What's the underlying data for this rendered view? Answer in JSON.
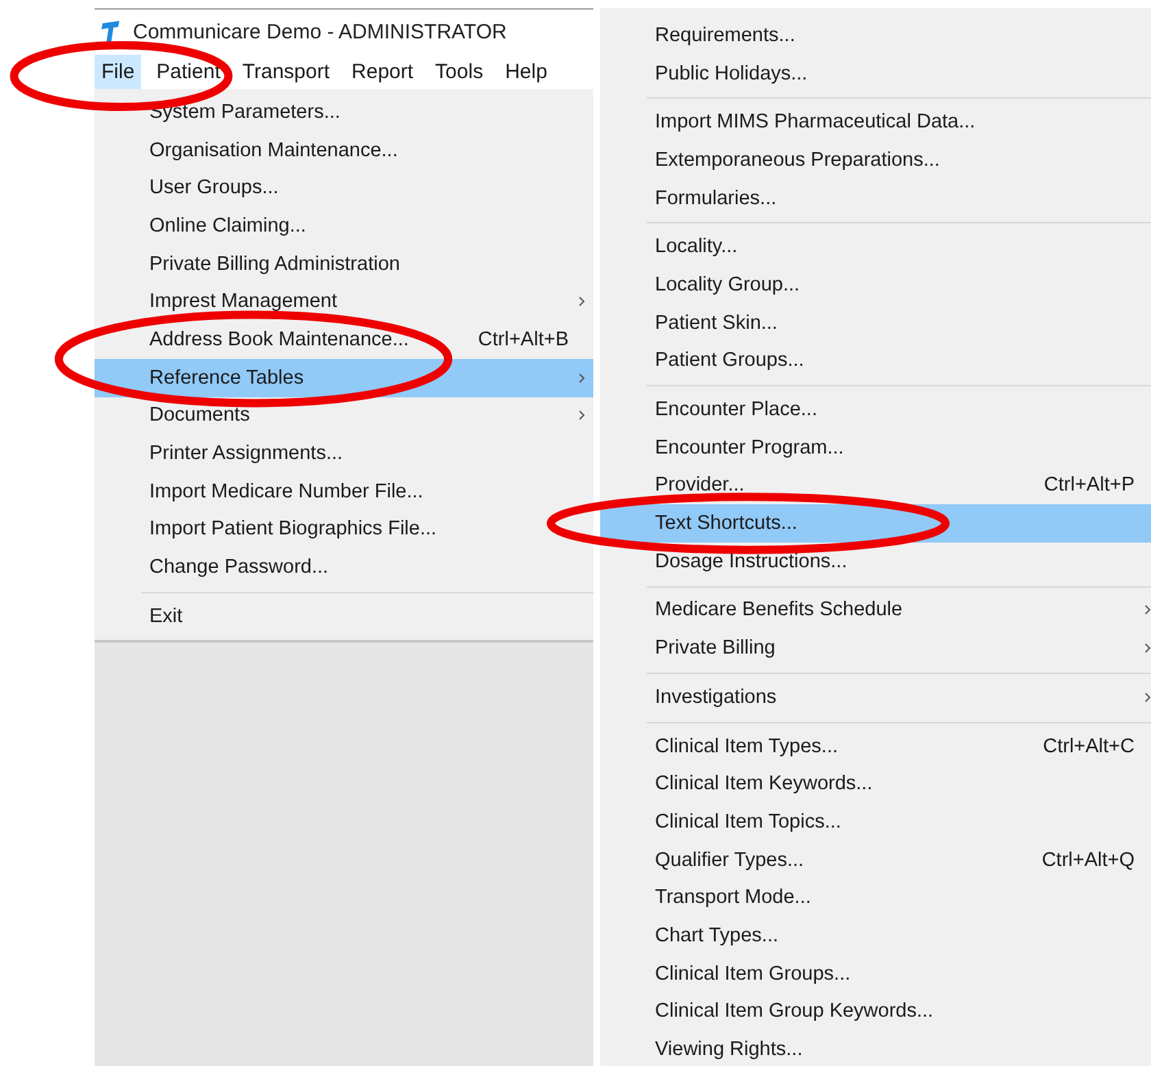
{
  "window": {
    "title": "Communicare Demo - ADMINISTRATOR"
  },
  "menubar": [
    {
      "label": "File",
      "selected": true,
      "circled": true
    },
    {
      "label": "Patient",
      "selected": false,
      "circled": false
    },
    {
      "label": "Transport",
      "selected": false,
      "circled": false
    },
    {
      "label": "Report",
      "selected": false,
      "circled": false
    },
    {
      "label": "Tools",
      "selected": false,
      "circled": false
    },
    {
      "label": "Help",
      "selected": false,
      "circled": false
    }
  ],
  "file_menu": {
    "items": [
      {
        "kind": "item",
        "label": "System Parameters...",
        "submenu": false,
        "selected": false,
        "circled": false
      },
      {
        "kind": "item",
        "label": "Organisation Maintenance...",
        "submenu": false,
        "selected": false,
        "circled": false
      },
      {
        "kind": "item",
        "label": "User Groups...",
        "submenu": false,
        "selected": false,
        "circled": false
      },
      {
        "kind": "item",
        "label": "Online Claiming...",
        "submenu": false,
        "selected": false,
        "circled": false
      },
      {
        "kind": "item",
        "label": "Private Billing Administration",
        "submenu": false,
        "selected": false,
        "circled": false
      },
      {
        "kind": "item",
        "label": "Imprest Management",
        "submenu": true,
        "selected": false,
        "circled": false
      },
      {
        "kind": "item",
        "label": "Address Book Maintenance...",
        "shortcut": "Ctrl+Alt+B",
        "submenu": false,
        "selected": false,
        "circled": false
      },
      {
        "kind": "item",
        "label": "Reference Tables",
        "submenu": true,
        "selected": true,
        "circled": true
      },
      {
        "kind": "item",
        "label": "Documents",
        "submenu": true,
        "selected": false,
        "circled": false
      },
      {
        "kind": "item",
        "label": "Printer Assignments...",
        "submenu": false,
        "selected": false,
        "circled": false
      },
      {
        "kind": "item",
        "label": "Import Medicare Number File...",
        "submenu": false,
        "selected": false,
        "circled": false
      },
      {
        "kind": "item",
        "label": "Import Patient Biographics File...",
        "submenu": false,
        "selected": false,
        "circled": false
      },
      {
        "kind": "item",
        "label": "Change Password...",
        "submenu": false,
        "selected": false,
        "circled": false
      },
      {
        "kind": "separator"
      },
      {
        "kind": "item",
        "label": "Exit",
        "submenu": false,
        "selected": false,
        "circled": false
      }
    ]
  },
  "reference_tables_menu": {
    "items": [
      {
        "kind": "item",
        "label": "Requirements...",
        "submenu": false,
        "selected": false,
        "circled": false
      },
      {
        "kind": "item",
        "label": "Public Holidays...",
        "submenu": false,
        "selected": false,
        "circled": false
      },
      {
        "kind": "separator"
      },
      {
        "kind": "item",
        "label": "Import MIMS Pharmaceutical Data...",
        "submenu": false,
        "selected": false,
        "circled": false
      },
      {
        "kind": "item",
        "label": "Extemporaneous Preparations...",
        "submenu": false,
        "selected": false,
        "circled": false
      },
      {
        "kind": "item",
        "label": "Formularies...",
        "submenu": false,
        "selected": false,
        "circled": false
      },
      {
        "kind": "separator"
      },
      {
        "kind": "item",
        "label": "Locality...",
        "submenu": false,
        "selected": false,
        "circled": false
      },
      {
        "kind": "item",
        "label": "Locality Group...",
        "submenu": false,
        "selected": false,
        "circled": false
      },
      {
        "kind": "item",
        "label": "Patient Skin...",
        "submenu": false,
        "selected": false,
        "circled": false
      },
      {
        "kind": "item",
        "label": "Patient Groups...",
        "submenu": false,
        "selected": false,
        "circled": false
      },
      {
        "kind": "separator"
      },
      {
        "kind": "item",
        "label": "Encounter Place...",
        "submenu": false,
        "selected": false,
        "circled": false
      },
      {
        "kind": "item",
        "label": "Encounter Program...",
        "submenu": false,
        "selected": false,
        "circled": false
      },
      {
        "kind": "item",
        "label": "Provider...",
        "shortcut": "Ctrl+Alt+P",
        "submenu": false,
        "selected": false,
        "circled": false
      },
      {
        "kind": "item",
        "label": "Text Shortcuts...",
        "submenu": false,
        "selected": true,
        "circled": true
      },
      {
        "kind": "item",
        "label": "Dosage Instructions...",
        "submenu": false,
        "selected": false,
        "circled": false
      },
      {
        "kind": "separator"
      },
      {
        "kind": "item",
        "label": "Medicare Benefits Schedule",
        "submenu": true,
        "selected": false,
        "circled": false
      },
      {
        "kind": "item",
        "label": "Private Billing",
        "submenu": true,
        "selected": false,
        "circled": false
      },
      {
        "kind": "separator"
      },
      {
        "kind": "item",
        "label": "Investigations",
        "submenu": true,
        "selected": false,
        "circled": false
      },
      {
        "kind": "separator"
      },
      {
        "kind": "item",
        "label": "Clinical Item Types...",
        "shortcut": "Ctrl+Alt+C",
        "submenu": false,
        "selected": false,
        "circled": false
      },
      {
        "kind": "item",
        "label": "Clinical Item Keywords...",
        "submenu": false,
        "selected": false,
        "circled": false
      },
      {
        "kind": "item",
        "label": "Clinical Item Topics...",
        "submenu": false,
        "selected": false,
        "circled": false
      },
      {
        "kind": "item",
        "label": "Qualifier Types...",
        "shortcut": "Ctrl+Alt+Q",
        "submenu": false,
        "selected": false,
        "circled": false
      },
      {
        "kind": "item",
        "label": "Transport Mode...",
        "submenu": false,
        "selected": false,
        "circled": false
      },
      {
        "kind": "item",
        "label": "Chart Types...",
        "submenu": false,
        "selected": false,
        "circled": false
      },
      {
        "kind": "item",
        "label": "Clinical Item Groups...",
        "submenu": false,
        "selected": false,
        "circled": false
      },
      {
        "kind": "item",
        "label": "Clinical Item Group Keywords...",
        "submenu": false,
        "selected": false,
        "circled": false
      },
      {
        "kind": "item",
        "label": "Viewing Rights...",
        "submenu": false,
        "selected": false,
        "circled": false
      }
    ]
  }
}
